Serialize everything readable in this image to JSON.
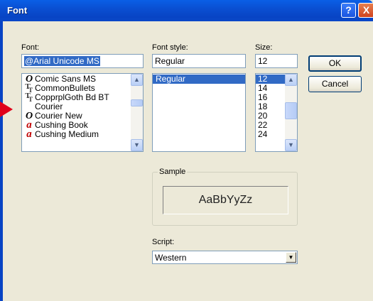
{
  "window": {
    "title": "Font",
    "help_glyph": "?",
    "close_glyph": "X"
  },
  "font": {
    "label": "Font:",
    "value": "@Arial Unicode MS",
    "items": [
      {
        "name": "Comic Sans MS",
        "icon": "opentype-icon"
      },
      {
        "name": "CommonBullets",
        "icon": "truetype-icon"
      },
      {
        "name": "CopprplGoth Bd BT",
        "icon": "truetype-icon"
      },
      {
        "name": "Courier",
        "icon": "none"
      },
      {
        "name": "Courier New",
        "icon": "opentype-icon"
      },
      {
        "name": "Cushing Book",
        "icon": "adobe-type-icon"
      },
      {
        "name": "Cushing Medium",
        "icon": "adobe-type-icon"
      }
    ]
  },
  "style": {
    "label": "Font style:",
    "value": "Regular",
    "items": [
      {
        "name": "Regular",
        "selected": true
      }
    ]
  },
  "size": {
    "label": "Size:",
    "value": "12",
    "items": [
      {
        "name": "12",
        "selected": true
      },
      {
        "name": "14",
        "selected": false
      },
      {
        "name": "16",
        "selected": false
      },
      {
        "name": "18",
        "selected": false
      },
      {
        "name": "20",
        "selected": false
      },
      {
        "name": "22",
        "selected": false
      },
      {
        "name": "24",
        "selected": false
      }
    ]
  },
  "buttons": {
    "ok": "OK",
    "cancel": "Cancel"
  },
  "sample": {
    "label": "Sample",
    "text": "AaBbYyZz"
  },
  "script": {
    "label": "Script:",
    "value": "Western"
  },
  "colors": {
    "titlebar": "#0a4fd2",
    "selection": "#316ac5",
    "arrow": "#e0001a",
    "dialog": "#ece9d8"
  }
}
